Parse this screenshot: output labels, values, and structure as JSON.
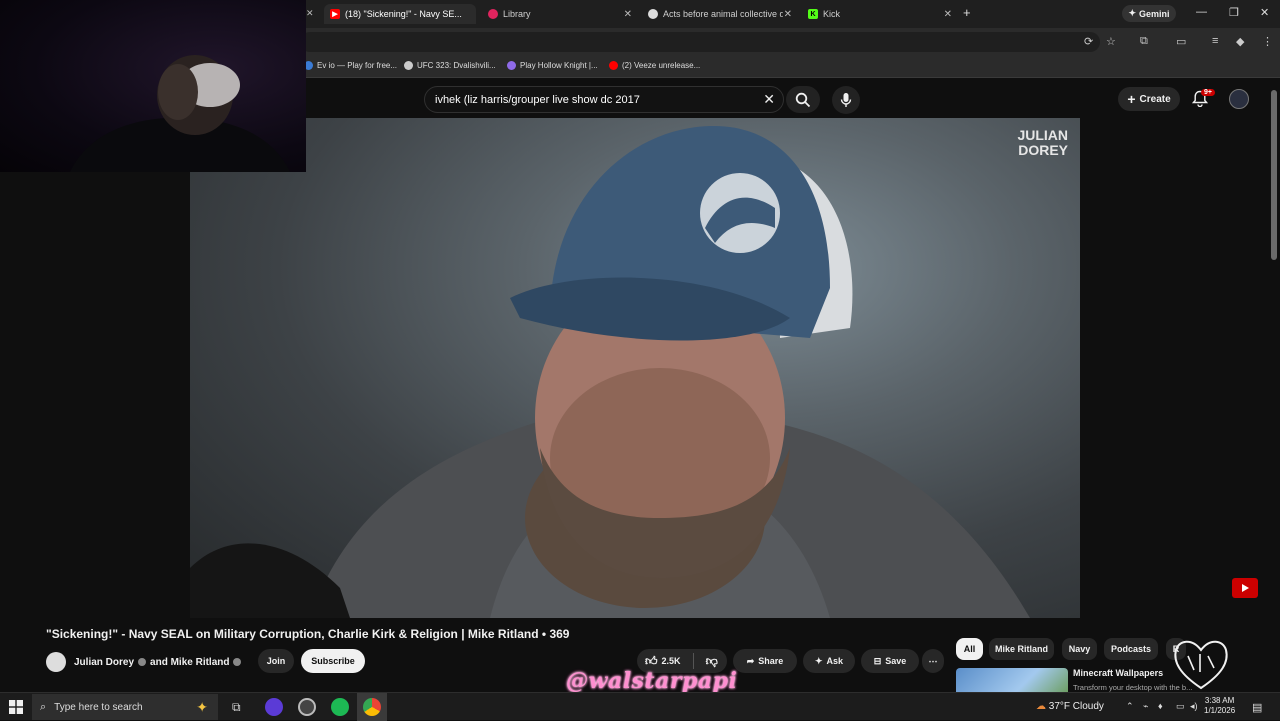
{
  "browser": {
    "tabs": [
      {
        "title": "(18) \"Sickening!\" - Navy SE...",
        "favicon_color": "#ff0000",
        "active": true
      },
      {
        "title": "Library",
        "favicon_color": "#e0245e",
        "active": false
      },
      {
        "title": "Acts before animal collective d...",
        "favicon_color": "#dddddd",
        "active": false
      },
      {
        "title": "Kick",
        "favicon_color": "#53fc18",
        "active": false
      }
    ],
    "gemini_label": "Gemini",
    "bookmarks": [
      {
        "label": "Ev io — Play for free...",
        "color": "#3a7bd5"
      },
      {
        "label": "UFC 323: Dvalishvili...",
        "color": "#cccccc"
      },
      {
        "label": "Play Hollow Knight |...",
        "color": "#8f6be8"
      },
      {
        "label": "(2) Veeze unrelease...",
        "color": "#ff0000"
      }
    ]
  },
  "youtube": {
    "search_query": "ivhek (liz harris/grouper live show dc 2017",
    "create_label": "Create",
    "notification_badge": "9+",
    "video": {
      "watermark_line1": "JULIAN",
      "watermark_line2": "DOREY",
      "title": "\"Sickening!\" - Navy SEAL on Military Corruption, Charlie Kirk & Religion | Mike Ritland • 369",
      "channel_name": "Julian Dorey",
      "collab_text": "and Mike Ritland",
      "join_label": "Join",
      "subscribe_label": "Subscribe",
      "likes": "2.5K",
      "share_label": "Share",
      "ask_label": "Ask",
      "save_label": "Save"
    },
    "chips": [
      "All",
      "Mike Ritland",
      "Navy",
      "Podcasts",
      "R"
    ],
    "suggestion": {
      "title": "Minecraft Wallpapers",
      "subtitle": "Transform your desktop with the b..."
    }
  },
  "overlay": {
    "handle": "@walstarpapi"
  },
  "taskbar": {
    "search_placeholder": "Type here to search",
    "weather": "37°F  Cloudy",
    "time": "3:38 AM",
    "date": "1/1/2026"
  }
}
